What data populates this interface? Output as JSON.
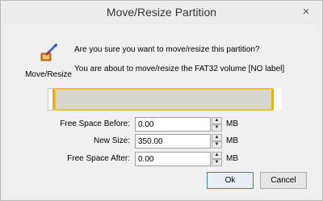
{
  "window": {
    "title": "Move/Resize Partition",
    "close_glyph": "×"
  },
  "tool": {
    "icon": "move-resize-icon",
    "label": "Move/Resize"
  },
  "messages": {
    "question": "Are you sure you want to move/resize this partition?",
    "info": "You are about to move/resize the FAT32 volume [NO label]"
  },
  "fields": [
    {
      "label": "Free Space Before:",
      "value": "0.00",
      "unit": "MB"
    },
    {
      "label": "New Size:",
      "value": "350.00",
      "unit": "MB"
    },
    {
      "label": "Free Space After:",
      "value": "0.00",
      "unit": "MB"
    }
  ],
  "spinner": {
    "up_glyph": "▲",
    "down_glyph": "▼"
  },
  "buttons": {
    "ok": "Ok",
    "cancel": "Cancel"
  },
  "colors": {
    "accent_border": "#f0c030",
    "volume_fill": "#d6d8cf",
    "ok_focus_border": "#3c7fb1"
  }
}
